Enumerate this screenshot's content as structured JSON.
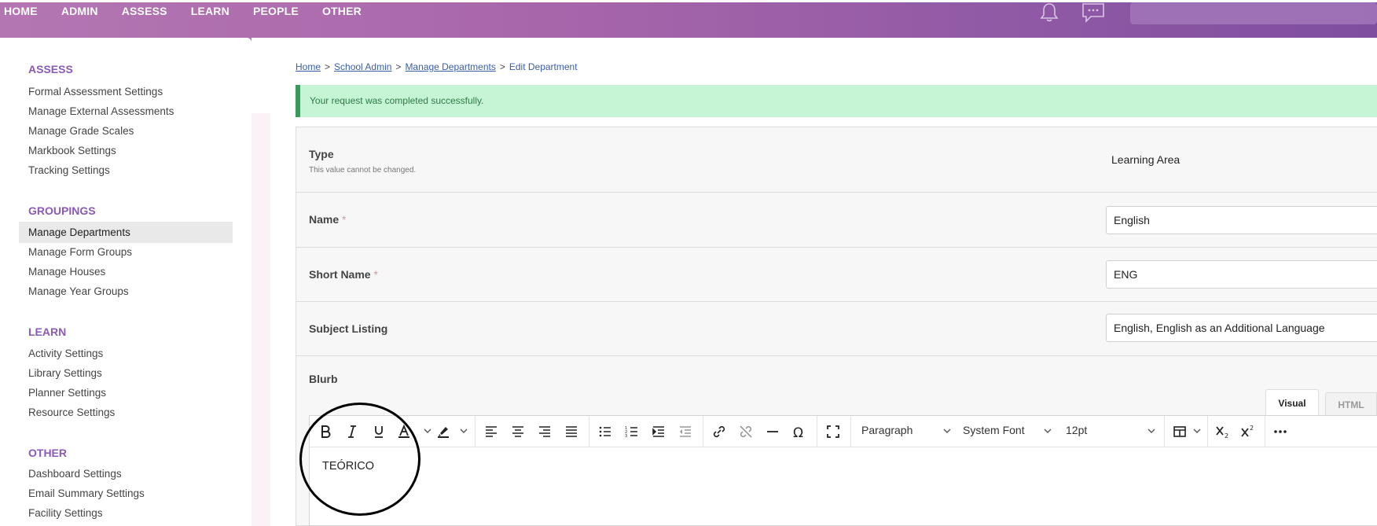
{
  "nav": {
    "items": [
      "HOME",
      "ADMIN",
      "ASSESS",
      "LEARN",
      "PEOPLE",
      "OTHER"
    ]
  },
  "header": {
    "icons": [
      "bell-icon",
      "chat-icon"
    ]
  },
  "sidebar": {
    "sections": [
      {
        "title": "ASSESS",
        "items": [
          "Formal Assessment Settings",
          "Manage External Assessments",
          "Manage Grade Scales",
          "Markbook Settings",
          "Tracking Settings"
        ]
      },
      {
        "title": "GROUPINGS",
        "items": [
          "Manage Departments",
          "Manage Form Groups",
          "Manage Houses",
          "Manage Year Groups"
        ]
      },
      {
        "title": "LEARN",
        "items": [
          "Activity Settings",
          "Library Settings",
          "Planner Settings",
          "Resource Settings"
        ]
      },
      {
        "title": "OTHER",
        "items": [
          "Dashboard Settings",
          "Email Summary Settings",
          "Facility Settings"
        ]
      }
    ],
    "active": "Manage Departments"
  },
  "breadcrumb": {
    "home": "Home",
    "school_admin": "School Admin",
    "manage_departments": "Manage Departments",
    "current": "Edit Department",
    "sep": ">"
  },
  "alert": {
    "message": "Your request was completed successfully."
  },
  "form": {
    "type": {
      "label": "Type",
      "note": "This value cannot be changed.",
      "value": "Learning Area"
    },
    "name": {
      "label": "Name",
      "required": "*",
      "value": "English"
    },
    "short_name": {
      "label": "Short Name",
      "required": "*",
      "value": "ENG"
    },
    "subject_listing": {
      "label": "Subject Listing",
      "value": "English, English as an Additional Language"
    },
    "blurb": {
      "label": "Blurb"
    }
  },
  "editor": {
    "tabs": {
      "visual": "Visual",
      "html": "HTML"
    },
    "block_format": "Paragraph",
    "font_family": "System Font",
    "font_size": "12pt",
    "content": "TEÓRICO"
  },
  "colors": {
    "accent": "#8b5ab5",
    "header_start": "#b476b3",
    "header_end": "#7f4e9f",
    "success_bg": "#c6f5d6",
    "success_border": "#3a9a5b"
  }
}
